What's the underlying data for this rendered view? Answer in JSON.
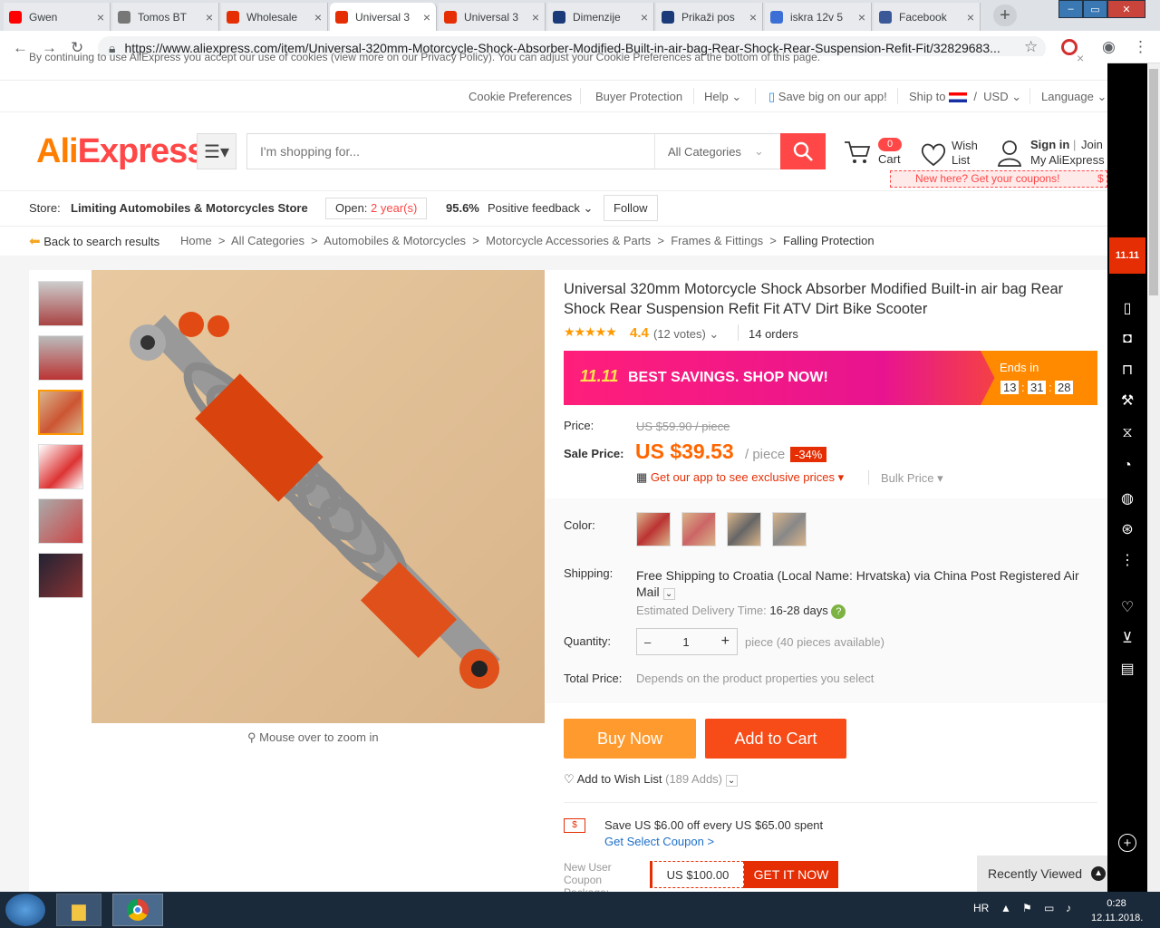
{
  "browser": {
    "tabs": [
      {
        "title": "Gwen",
        "color": "#ff0000",
        "icon": "youtube-icon",
        "active": false
      },
      {
        "title": "Tomos BT",
        "color": "#777777",
        "icon": "scooter-icon",
        "active": false
      },
      {
        "title": "Wholesale",
        "color": "#e62e04",
        "icon": "aliexpress-icon",
        "active": false
      },
      {
        "title": "Universal 3",
        "color": "#e62e04",
        "icon": "aliexpress-icon",
        "active": true
      },
      {
        "title": "Universal 3",
        "color": "#e62e04",
        "icon": "aliexpress-icon",
        "active": false
      },
      {
        "title": "Dimenzije",
        "color": "#1a3a7a",
        "icon": "site-icon",
        "active": false
      },
      {
        "title": "Prikaži pos",
        "color": "#1a3a7a",
        "icon": "site-icon",
        "active": false
      },
      {
        "title": "iskra 12v 5",
        "color": "#3b6fd6",
        "icon": "p-icon",
        "active": false
      },
      {
        "title": "Facebook",
        "color": "#3b5998",
        "icon": "facebook-icon",
        "active": false
      }
    ],
    "url": "https://www.aliexpress.com/item/Universal-320mm-Motorcycle-Shock-Absorber-Modified-Built-in-air-bag-Rear-Shock-Rear-Suspension-Refit-Fit/32829683..."
  },
  "cookie_text": "By continuing to use AliExpress you accept our use of cookies (view more on our Privacy Policy). You can adjust your Cookie Preferences at the bottom of this page.",
  "topbar": {
    "cookie_prefs": "Cookie Preferences",
    "buyer_protection": "Buyer Protection",
    "help": "Help",
    "app": "Save big on our app!",
    "ship_to": "Ship to",
    "currency": "USD",
    "language": "Language"
  },
  "header": {
    "logo_a": "Ali",
    "logo_b": "Express",
    "search_placeholder": "I'm shopping for...",
    "categories": "All Categories",
    "cart_count": "0",
    "cart": "Cart",
    "wish": "Wish",
    "list": "List",
    "sign_in": "Sign in",
    "join": "Join",
    "my_ali": "My AliExpress",
    "coupon_strip": "New here? Get your coupons!"
  },
  "store": {
    "label": "Store:",
    "name": "Limiting Automobiles & Motorcycles Store",
    "open_prefix": "Open:",
    "open_years": "2 year(s)",
    "feedback_pct": "95.6%",
    "feedback": "Positive feedback",
    "follow": "Follow"
  },
  "crumbs": {
    "back": "Back to search results",
    "path": [
      "Home",
      "All Categories",
      "Automobiles & Motorcycles",
      "Motorcycle Accessories & Parts",
      "Frames & Fittings",
      "Falling Protection"
    ]
  },
  "product": {
    "zoom_hint": "Mouse over to zoom in",
    "title": "Universal 320mm Motorcycle Shock Absorber Modified Built-in air bag Rear Shock Rear Suspension Refit Fit ATV Dirt Bike Scooter",
    "rating": "4.4",
    "stars": 4.4,
    "votes": "(12 votes)",
    "orders": "14 orders",
    "banner_text": "BEST SAVINGS. SHOP NOW!",
    "banner_mark": "11.11",
    "ends_in": "Ends in",
    "timer": [
      "13",
      "31",
      "28"
    ],
    "price_label": "Price:",
    "old_price": "US $59.90 / piece",
    "sale_label": "Sale Price:",
    "sale_price": "US $39.53",
    "per": "/ piece",
    "discount": "-34%",
    "app_prices": "Get our app to see exclusive prices",
    "bulk": "Bulk Price",
    "color_label": "Color:",
    "shipping_label": "Shipping:",
    "shipping_text": "Free Shipping to Croatia (Local Name: Hrvatska) via China Post Registered Air Mail",
    "delivery_label": "Estimated Delivery Time:",
    "delivery": "16-28 days",
    "qty_label": "Quantity:",
    "qty": "1",
    "qty_avail": "piece (40 pieces available)",
    "total_label": "Total Price:",
    "total": "Depends on the product properties you select",
    "buy_now": "Buy Now",
    "add_cart": "Add to Cart",
    "wish": "Add to Wish List",
    "wish_count": "(189 Adds)",
    "coupon_text": "Save US $6.00 off every US $65.00 spent",
    "coupon_link": "Get Select Coupon >",
    "new_user": "New User Coupon Package:",
    "new_user_amt": "US $100.00",
    "get_it": "GET IT NOW",
    "recent": "Recently Viewed"
  },
  "taskbar": {
    "lang": "HR",
    "time": "0:28",
    "date": "12.11.2018."
  }
}
